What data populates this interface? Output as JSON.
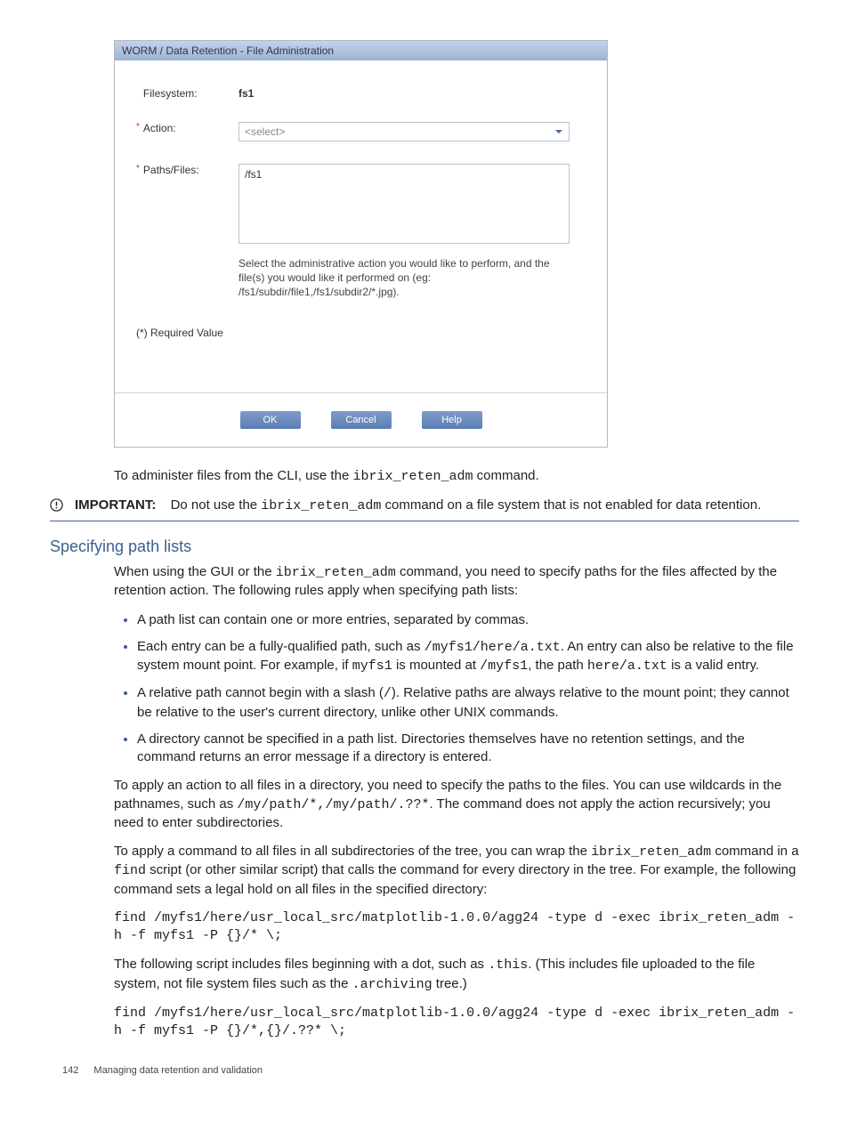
{
  "dialog": {
    "title": "WORM / Data Retention - File Administration",
    "filesystem_label": "Filesystem:",
    "filesystem_value": "fs1",
    "action_label": "Action:",
    "action_placeholder": "<select>",
    "paths_label": "Paths/Files:",
    "paths_value": "/fs1",
    "helper": "Select the administrative action you would like to perform, and the file(s) you would like it performed on\n(eg: /fs1/subdir/file1,/fs1/subdir2/*.jpg).",
    "required_note": "(*) Required Value",
    "ok": "OK",
    "cancel": "Cancel",
    "help": "Help"
  },
  "cli_line_pre": "To administer files from the CLI, use the ",
  "cli_cmd": "ibrix_reten_adm",
  "cli_line_post": " command.",
  "important_label": "IMPORTANT:",
  "important_pre": "Do not use the ",
  "important_cmd": "ibrix_reten_adm",
  "important_post": " command on a file system that is not enabled for data retention.",
  "section_heading": "Specifying path lists",
  "p1_pre": "When using the GUI or the ",
  "p1_cmd": "ibrix_reten_adm",
  "p1_post": " command, you need to specify paths for the files affected by the retention action. The following rules apply when specifying path lists:",
  "bullets": {
    "b1": "A path list can contain one or more entries, separated by commas.",
    "b2_pre": "Each entry can be a fully-qualified path, such as ",
    "b2_c1": "/myfs1/here/a.txt",
    "b2_mid": ". An entry can also be relative to the file system mount point. For example, if ",
    "b2_c2": "myfs1",
    "b2_mid2": " is mounted at ",
    "b2_c3": "/myfs1",
    "b2_mid3": ", the path ",
    "b2_c4": "here/a.txt",
    "b2_post": " is a valid entry.",
    "b3_pre": "A relative path cannot begin with a slash (",
    "b3_c1": "/",
    "b3_post": "). Relative paths are always relative to the mount point; they cannot be relative to the user's current directory, unlike other UNIX commands.",
    "b4": "A directory cannot be specified in a path list. Directories themselves have no retention settings, and the command returns an error message if a directory is entered."
  },
  "p2_pre": "To apply an action to all files in a directory, you need to specify the paths to the files. You can use wildcards in the pathnames, such as ",
  "p2_c1": "/my/path/*,/my/path/.??*",
  "p2_post": ". The command does not apply the action recursively; you need to enter subdirectories.",
  "p3_pre": "To apply a command to all files in all subdirectories of the tree, you can wrap the ",
  "p3_c1": "ibrix_reten_adm",
  "p3_mid": " command in a ",
  "p3_c2": "find",
  "p3_post": " script (or other similar script) that calls the command for every directory in the tree. For example, the following command sets a legal hold on all files in the specified directory:",
  "code1": "find /myfs1/here/usr_local_src/matplotlib-1.0.0/agg24 -type d -exec ibrix_reten_adm -h -f myfs1 -P {}/* \\;",
  "p4_pre": "The following script includes files beginning with a dot, such as ",
  "p4_c1": ".this",
  "p4_mid": ". (This includes file uploaded to the file system, not file system files such as the ",
  "p4_c2": ".archiving",
  "p4_post": " tree.)",
  "code2": "find /myfs1/here/usr_local_src/matplotlib-1.0.0/agg24 -type d -exec ibrix_reten_adm -h -f myfs1 -P {}/*,{}/.??* \\;",
  "footer_page": "142",
  "footer_text": "Managing data retention and validation"
}
